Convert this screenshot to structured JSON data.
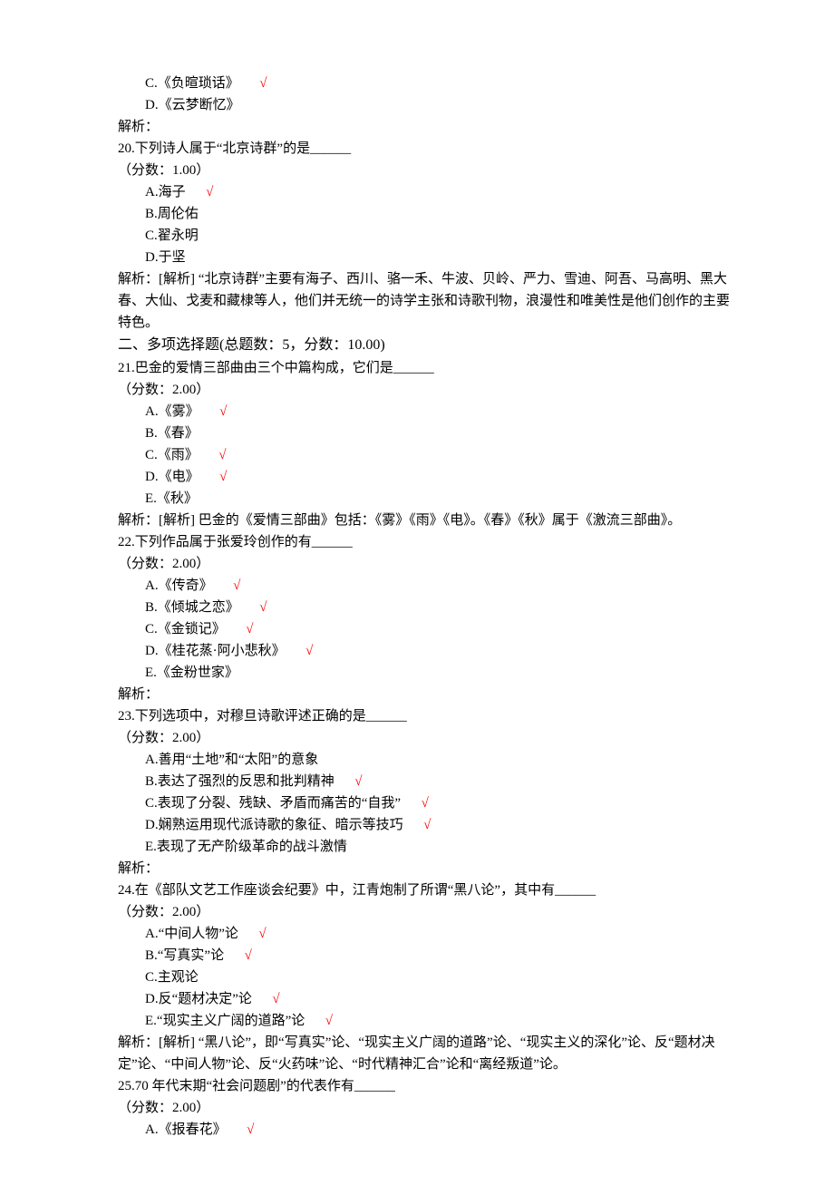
{
  "q19": {
    "optC": "C.《负暄琐话》",
    "optD": "D.《云梦断忆》",
    "analysis": "解析："
  },
  "q20": {
    "stem": "20.下列诗人属于“北京诗群”的是______",
    "score": "（分数：1.00）",
    "optA": "A.海子",
    "optB": "B.周伦佑",
    "optC": "C.翟永明",
    "optD": "D.于坚",
    "analysis": "解析：[解析] “北京诗群”主要有海子、西川、骆一禾、牛波、贝岭、严力、雪迪、阿吾、马高明、黑大春、大仙、戈麦和藏棣等人，他们并无统一的诗学主张和诗歌刊物，浪漫性和唯美性是他们创作的主要特色。"
  },
  "section2": "二、多项选择题(总题数：5，分数：10.00)",
  "q21": {
    "stem": "21.巴金的爱情三部曲由三个中篇构成，它们是______",
    "score": "（分数：2.00）",
    "optA": "A.《雾》",
    "optB": "B.《春》",
    "optC": "C.《雨》",
    "optD": "D.《电》",
    "optE": "E.《秋》",
    "analysis": "解析：[解析] 巴金的《爱情三部曲》包括：《雾》《雨》《电》。《春》《秋》属于《激流三部曲》。"
  },
  "q22": {
    "stem": "22.下列作品属于张爱玲创作的有______",
    "score": "（分数：2.00）",
    "optA": "A.《传奇》",
    "optB": "B.《倾城之恋》",
    "optC": "C.《金锁记》",
    "optD": "D.《桂花蒸·阿小悲秋》",
    "optE": "E.《金粉世家》",
    "analysis": "解析："
  },
  "q23": {
    "stem": "23.下列选项中，对穆旦诗歌评述正确的是______",
    "score": "（分数：2.00）",
    "optA": "A.善用“土地”和“太阳”的意象",
    "optB": "B.表达了强烈的反思和批判精神",
    "optC": "C.表现了分裂、残缺、矛盾而痛苦的“自我”",
    "optD": "D.娴熟运用现代派诗歌的象征、暗示等技巧",
    "optE": "E.表现了无产阶级革命的战斗激情",
    "analysis": "解析："
  },
  "q24": {
    "stem": "24.在《部队文艺工作座谈会纪要》中，江青炮制了所谓“黑八论”，其中有______",
    "score": "（分数：2.00）",
    "optA": "A.“中间人物”论",
    "optB": "B.“写真实”论",
    "optC": "C.主观论",
    "optD": "D.反“题材决定”论",
    "optE": "E.“现实主义广阔的道路”论",
    "analysis": "解析：[解析] “黑八论”，即“写真实”论、“现实主义广阔的道路”论、“现实主义的深化”论、反“题材决定”论、“中间人物”论、反“火药味”论、“时代精神汇合”论和“离经叛道”论。"
  },
  "q25": {
    "stem": "25.70 年代末期“社会问题剧”的代表作有______",
    "score": "（分数：2.00）",
    "optA": "A.《报春花》"
  },
  "checkmark": "√"
}
